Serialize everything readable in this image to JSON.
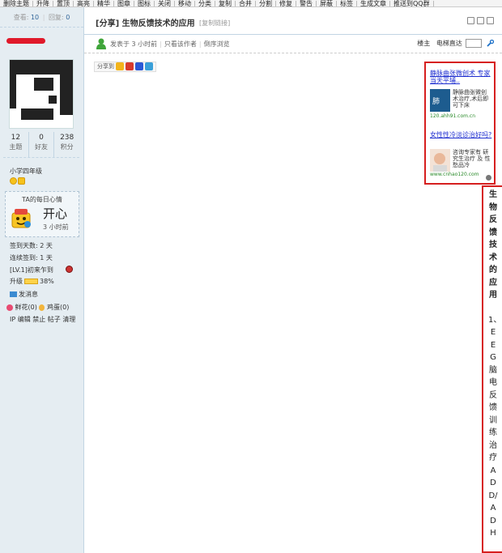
{
  "toolbar": {
    "items": [
      "删除主题",
      "升降",
      "置顶",
      "高亮",
      "精华",
      "图章",
      "图标",
      "关闭",
      "移动",
      "分类",
      "复制",
      "合并",
      "分割",
      "修复",
      "警告",
      "屏蔽",
      "标签",
      "生成文章",
      "推送到QQ群"
    ]
  },
  "sidebar": {
    "views_label": "查看:",
    "views": "10",
    "replies_label": "回复:",
    "replies": "0",
    "stats": [
      {
        "value": "12",
        "label": "主题"
      },
      {
        "value": "0",
        "label": "好友"
      },
      {
        "value": "238",
        "label": "积分"
      }
    ],
    "level": "小学四年级",
    "mood": {
      "title": "TA的每日心情",
      "word": "开心",
      "time": "3 小时前"
    },
    "signin_days": "签到天数: 2 天",
    "consecutive": "连续签到: 1 天",
    "lv": "[LV.1]初来乍到",
    "upgrade_label": "升级",
    "upgrade_percent": 38,
    "upgrade_text": "38%",
    "send_message": "发消息",
    "flower": "鲜花(0)",
    "egg": "鸡蛋(0)",
    "admin_links": "IP 编辑 禁止 帖子 清理"
  },
  "post": {
    "title": "[分享] 生物反馈技术的应用",
    "copy_link": "[复制链接]",
    "posted": "发表于 3 小时前",
    "author_only": "只看该作者",
    "reverse": "倒序浏览",
    "floor": "楼主",
    "jump_label": "电梯直达",
    "share_label": "分享到"
  },
  "ad": {
    "link1": "静脉曲张微创术 专家当天平埔..",
    "desc1": "静脉曲张微创术治疗,术后即可下床",
    "url1": "120.ahh91.com.cn",
    "link2": "女性性冷淡诊治好吗?",
    "desc2": "咨询专家有 研究生治疗 及 性愁品冷",
    "url2": "www.cnhao120.com"
  },
  "content": {
    "heading": "生物反馈技术的应用",
    "body": "1、EEG脑电反馈训练治疗ADD/ADH"
  },
  "colors": {
    "accent_red": "#d61f1f",
    "sidebar_bg": "#e5edf2",
    "link_blue": "#1f2fd0"
  }
}
